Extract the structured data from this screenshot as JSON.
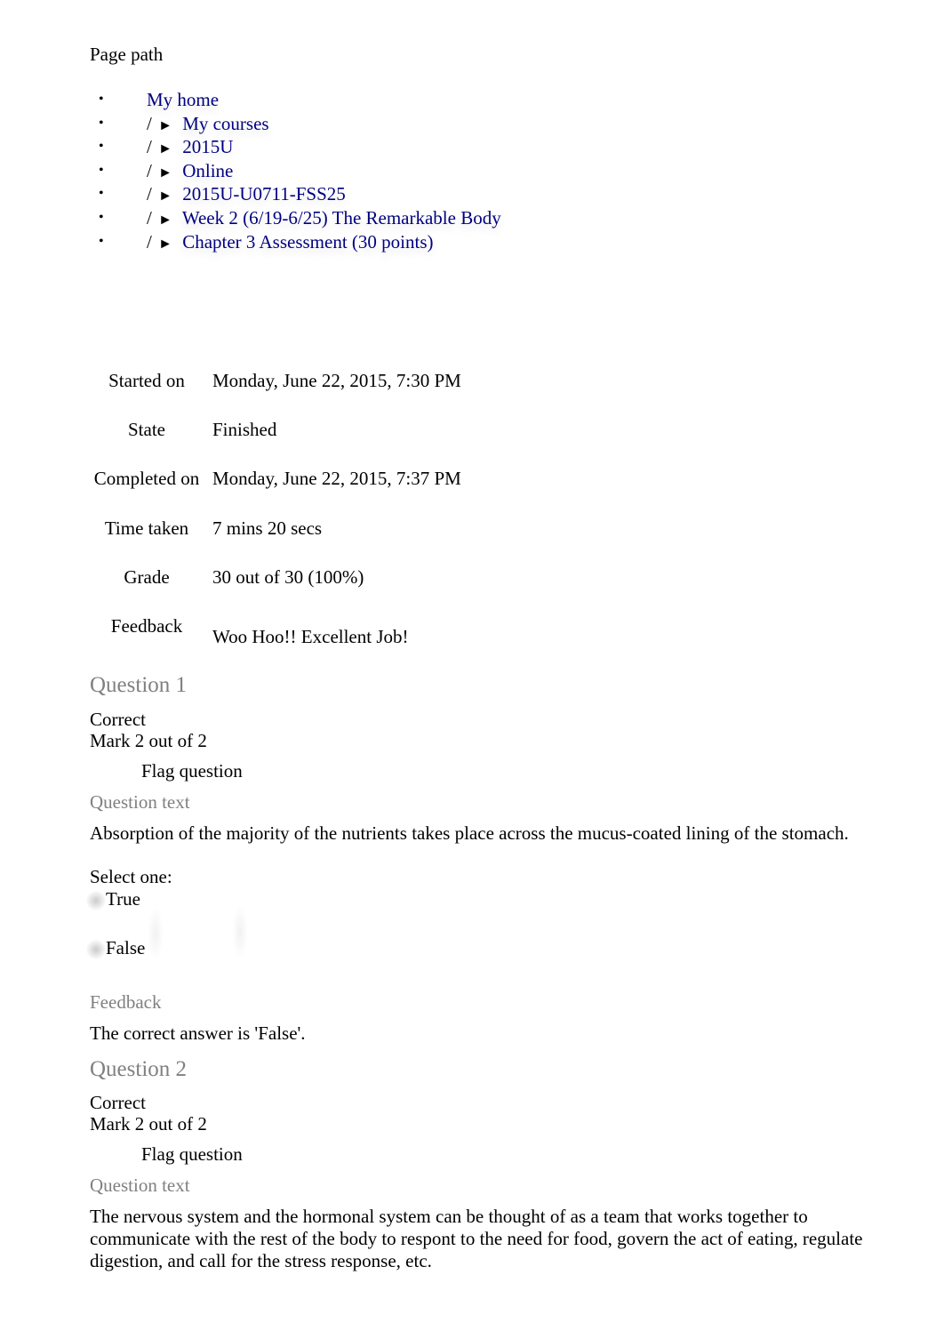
{
  "breadcrumb": {
    "label": "Page path",
    "separator": "/",
    "arrow": "►",
    "bullet": "•",
    "items": [
      {
        "label": "My home"
      },
      {
        "label": "My courses"
      },
      {
        "label": "2015U"
      },
      {
        "label": "Online"
      },
      {
        "label": "2015U-U0711-FSS25"
      },
      {
        "label": "Week 2 (6/19-6/25) The Remarkable Body"
      },
      {
        "label": "Chapter 3 Assessment (30 points)"
      }
    ]
  },
  "summary": {
    "rows": [
      {
        "label": "Started on",
        "value": "Monday, June 22, 2015, 7:30 PM"
      },
      {
        "label": "State",
        "value": "Finished"
      },
      {
        "label": "Completed on",
        "value": "Monday, June 22, 2015, 7:37 PM"
      },
      {
        "label": "Time taken",
        "value": "7 mins 20 secs"
      },
      {
        "label": "Grade",
        "value": "30 out of 30 (100%)"
      },
      {
        "label": "Feedback",
        "value": "Woo Hoo!! Excellent Job!"
      }
    ]
  },
  "questions": [
    {
      "title": "Question 1",
      "status": "Correct",
      "mark": "Mark 2 out of 2",
      "flag_label": "Flag question",
      "text_heading": "Question text",
      "text": "Absorption of the majority of the nutrients takes place across the mucus-coated lining of the stomach.",
      "prompt": "Select one:",
      "options": [
        {
          "label": "True"
        },
        {
          "label": "False"
        }
      ],
      "feedback_heading": "Feedback",
      "feedback": "The correct answer is 'False'."
    },
    {
      "title": "Question 2",
      "status": "Correct",
      "mark": "Mark 2 out of 2",
      "flag_label": "Flag question",
      "text_heading": "Question text",
      "text": "The nervous system and the hormonal system can be thought of as a team that works together to communicate with the rest of the body to respont to the need for food, govern the act of eating, regulate digestion, and call for the stress response, etc."
    }
  ],
  "colors": {
    "link": "#000080",
    "muted": "#808080"
  }
}
